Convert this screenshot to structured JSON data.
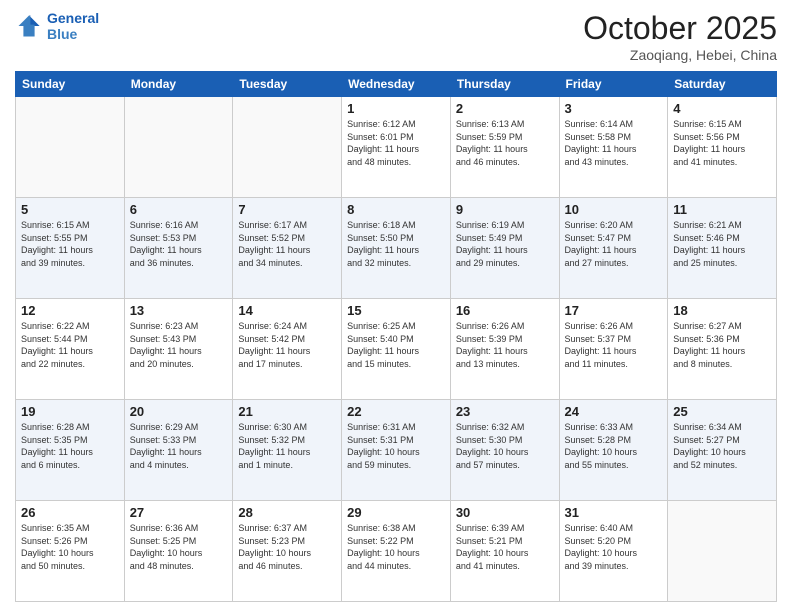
{
  "header": {
    "logo_line1": "General",
    "logo_line2": "Blue",
    "month_title": "October 2025",
    "location": "Zaoqiang, Hebei, China"
  },
  "weekdays": [
    "Sunday",
    "Monday",
    "Tuesday",
    "Wednesday",
    "Thursday",
    "Friday",
    "Saturday"
  ],
  "weeks": [
    [
      {
        "day": "",
        "info": ""
      },
      {
        "day": "",
        "info": ""
      },
      {
        "day": "",
        "info": ""
      },
      {
        "day": "1",
        "info": "Sunrise: 6:12 AM\nSunset: 6:01 PM\nDaylight: 11 hours\nand 48 minutes."
      },
      {
        "day": "2",
        "info": "Sunrise: 6:13 AM\nSunset: 5:59 PM\nDaylight: 11 hours\nand 46 minutes."
      },
      {
        "day": "3",
        "info": "Sunrise: 6:14 AM\nSunset: 5:58 PM\nDaylight: 11 hours\nand 43 minutes."
      },
      {
        "day": "4",
        "info": "Sunrise: 6:15 AM\nSunset: 5:56 PM\nDaylight: 11 hours\nand 41 minutes."
      }
    ],
    [
      {
        "day": "5",
        "info": "Sunrise: 6:15 AM\nSunset: 5:55 PM\nDaylight: 11 hours\nand 39 minutes."
      },
      {
        "day": "6",
        "info": "Sunrise: 6:16 AM\nSunset: 5:53 PM\nDaylight: 11 hours\nand 36 minutes."
      },
      {
        "day": "7",
        "info": "Sunrise: 6:17 AM\nSunset: 5:52 PM\nDaylight: 11 hours\nand 34 minutes."
      },
      {
        "day": "8",
        "info": "Sunrise: 6:18 AM\nSunset: 5:50 PM\nDaylight: 11 hours\nand 32 minutes."
      },
      {
        "day": "9",
        "info": "Sunrise: 6:19 AM\nSunset: 5:49 PM\nDaylight: 11 hours\nand 29 minutes."
      },
      {
        "day": "10",
        "info": "Sunrise: 6:20 AM\nSunset: 5:47 PM\nDaylight: 11 hours\nand 27 minutes."
      },
      {
        "day": "11",
        "info": "Sunrise: 6:21 AM\nSunset: 5:46 PM\nDaylight: 11 hours\nand 25 minutes."
      }
    ],
    [
      {
        "day": "12",
        "info": "Sunrise: 6:22 AM\nSunset: 5:44 PM\nDaylight: 11 hours\nand 22 minutes."
      },
      {
        "day": "13",
        "info": "Sunrise: 6:23 AM\nSunset: 5:43 PM\nDaylight: 11 hours\nand 20 minutes."
      },
      {
        "day": "14",
        "info": "Sunrise: 6:24 AM\nSunset: 5:42 PM\nDaylight: 11 hours\nand 17 minutes."
      },
      {
        "day": "15",
        "info": "Sunrise: 6:25 AM\nSunset: 5:40 PM\nDaylight: 11 hours\nand 15 minutes."
      },
      {
        "day": "16",
        "info": "Sunrise: 6:26 AM\nSunset: 5:39 PM\nDaylight: 11 hours\nand 13 minutes."
      },
      {
        "day": "17",
        "info": "Sunrise: 6:26 AM\nSunset: 5:37 PM\nDaylight: 11 hours\nand 11 minutes."
      },
      {
        "day": "18",
        "info": "Sunrise: 6:27 AM\nSunset: 5:36 PM\nDaylight: 11 hours\nand 8 minutes."
      }
    ],
    [
      {
        "day": "19",
        "info": "Sunrise: 6:28 AM\nSunset: 5:35 PM\nDaylight: 11 hours\nand 6 minutes."
      },
      {
        "day": "20",
        "info": "Sunrise: 6:29 AM\nSunset: 5:33 PM\nDaylight: 11 hours\nand 4 minutes."
      },
      {
        "day": "21",
        "info": "Sunrise: 6:30 AM\nSunset: 5:32 PM\nDaylight: 11 hours\nand 1 minute."
      },
      {
        "day": "22",
        "info": "Sunrise: 6:31 AM\nSunset: 5:31 PM\nDaylight: 10 hours\nand 59 minutes."
      },
      {
        "day": "23",
        "info": "Sunrise: 6:32 AM\nSunset: 5:30 PM\nDaylight: 10 hours\nand 57 minutes."
      },
      {
        "day": "24",
        "info": "Sunrise: 6:33 AM\nSunset: 5:28 PM\nDaylight: 10 hours\nand 55 minutes."
      },
      {
        "day": "25",
        "info": "Sunrise: 6:34 AM\nSunset: 5:27 PM\nDaylight: 10 hours\nand 52 minutes."
      }
    ],
    [
      {
        "day": "26",
        "info": "Sunrise: 6:35 AM\nSunset: 5:26 PM\nDaylight: 10 hours\nand 50 minutes."
      },
      {
        "day": "27",
        "info": "Sunrise: 6:36 AM\nSunset: 5:25 PM\nDaylight: 10 hours\nand 48 minutes."
      },
      {
        "day": "28",
        "info": "Sunrise: 6:37 AM\nSunset: 5:23 PM\nDaylight: 10 hours\nand 46 minutes."
      },
      {
        "day": "29",
        "info": "Sunrise: 6:38 AM\nSunset: 5:22 PM\nDaylight: 10 hours\nand 44 minutes."
      },
      {
        "day": "30",
        "info": "Sunrise: 6:39 AM\nSunset: 5:21 PM\nDaylight: 10 hours\nand 41 minutes."
      },
      {
        "day": "31",
        "info": "Sunrise: 6:40 AM\nSunset: 5:20 PM\nDaylight: 10 hours\nand 39 minutes."
      },
      {
        "day": "",
        "info": ""
      }
    ]
  ]
}
